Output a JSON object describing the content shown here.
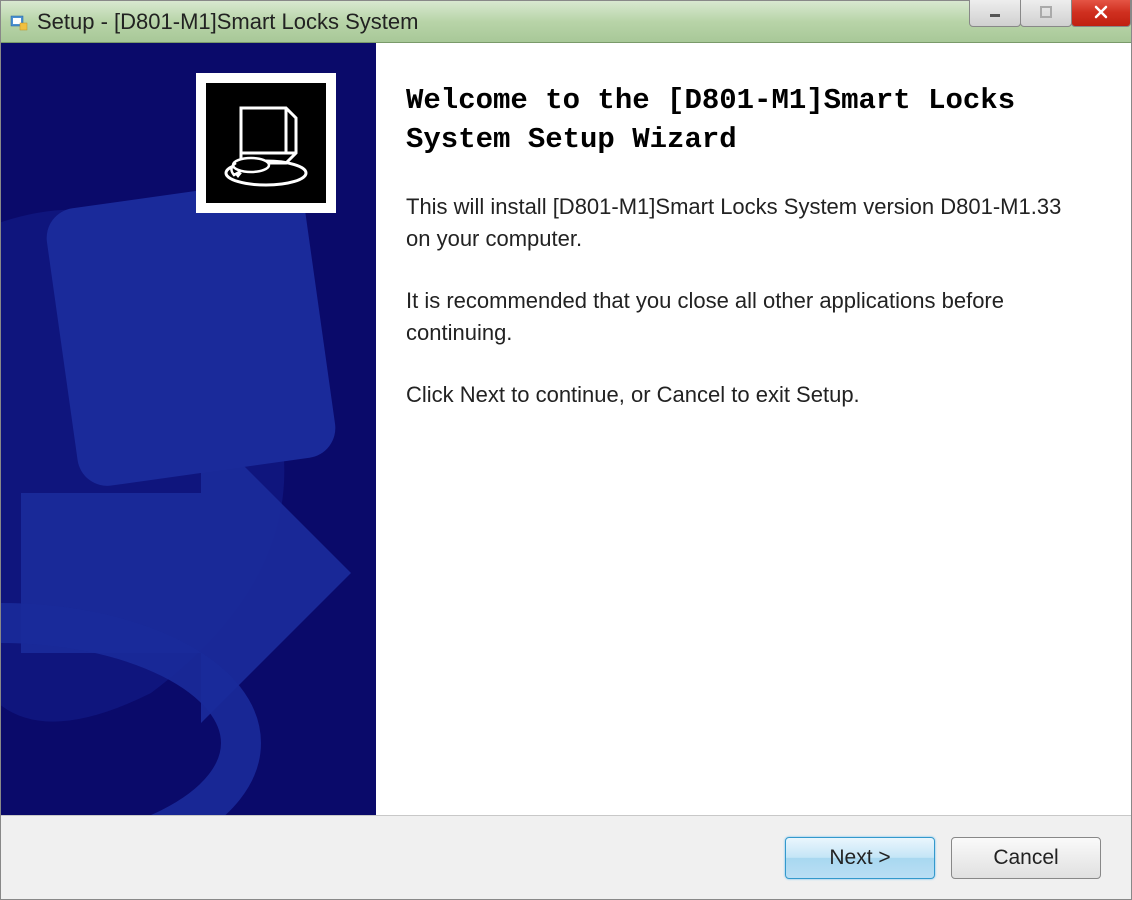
{
  "titlebar": {
    "title": "Setup - [D801-M1]Smart Locks System"
  },
  "window_controls": {
    "minimize_icon": "minimize-icon",
    "maximize_icon": "maximize-icon",
    "close_icon": "close-icon"
  },
  "main": {
    "heading": "Welcome to the [D801-M1]Smart Locks System Setup Wizard",
    "paragraph1": "This will install [D801-M1]Smart Locks System version D801-M1.33 on your computer.",
    "paragraph2": "It is recommended that you close all other applications before continuing.",
    "paragraph3": "Click Next to continue, or Cancel to exit Setup."
  },
  "buttons": {
    "next_label": "Next >",
    "cancel_label": "Cancel"
  },
  "colors": {
    "sidebar_bg": "#0a0a6a",
    "sidebar_accent": "#1a2a9a"
  }
}
